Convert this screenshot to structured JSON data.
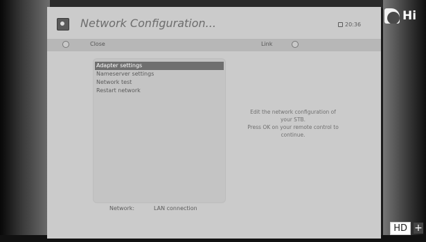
{
  "channel": {
    "logo_text": "Hi"
  },
  "badge": {
    "hd_label": "HD",
    "plus_label": "+"
  },
  "window": {
    "title": "Network Configuration...",
    "clock": "20:36"
  },
  "toolbar": {
    "left_label": "Close",
    "right_label": "Link"
  },
  "menu": {
    "items": [
      {
        "label": "Adapter settings",
        "selected": true
      },
      {
        "label": "Nameserver settings",
        "selected": false
      },
      {
        "label": "Network test",
        "selected": false
      },
      {
        "label": "Restart network",
        "selected": false
      }
    ]
  },
  "description": {
    "line1": "Edit the network configuration of",
    "line2": "your STB.",
    "line3": "Press OK on your remote control to",
    "line4": "continue."
  },
  "footer": {
    "label": "Network:",
    "value": "LAN connection"
  },
  "colors": {
    "menu_bg": "#cbcbcb",
    "selected_bg": "#6f6f6f",
    "toolbar_bg": "#b7b7b7"
  }
}
